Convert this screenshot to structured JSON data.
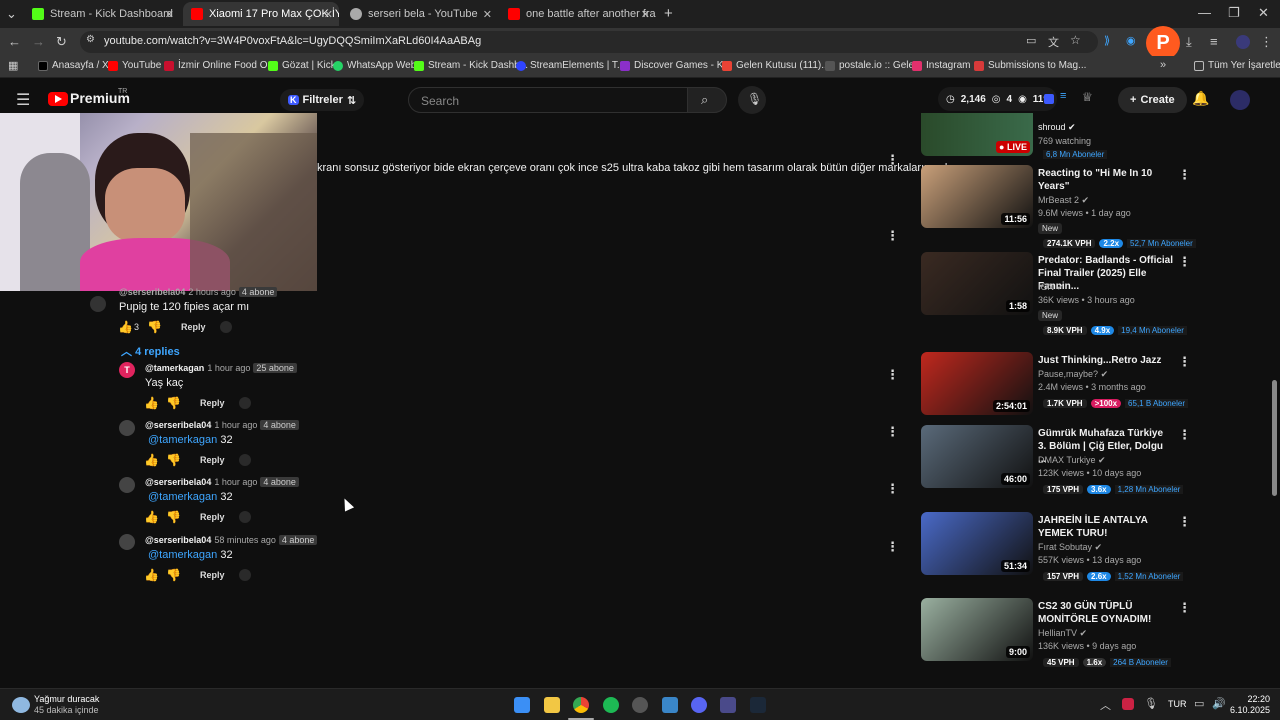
{
  "browser": {
    "tabs": [
      {
        "title": "Stream - Kick Dashboard",
        "color": "#53fc18",
        "active": false
      },
      {
        "title": "Xiaomi 17 Pro Max ÇOK İYİ (KU",
        "color": "#ff0000",
        "active": true
      },
      {
        "title": "serseri bela - YouTube",
        "color": "#aaaaaa",
        "active": false
      },
      {
        "title": "one battle after another fragma",
        "color": "#ff0000",
        "active": false
      }
    ],
    "url": "youtube.com/watch?v=3W4P0voxFtA&lc=UgyDQQSmiImXaRLd60I4AaABAg",
    "bookmarks": [
      {
        "label": "Anasayfa / X",
        "color": "#000000"
      },
      {
        "label": "YouTube",
        "color": "#ff0000"
      },
      {
        "label": "İzmir Online Food O...",
        "color": "#c8102e"
      },
      {
        "label": "Gözat | Kick",
        "color": "#53fc18"
      },
      {
        "label": "WhatsApp Web",
        "color": "#25d366"
      },
      {
        "label": "Stream - Kick Dashb...",
        "color": "#53fc18"
      },
      {
        "label": "StreamElements | T...",
        "color": "#2f44ff"
      },
      {
        "label": "Discover Games - K...",
        "color": "#8b2fc9"
      },
      {
        "label": "Gelen Kutusu (111)...",
        "color": "#ea4335"
      },
      {
        "label": "postale.io :: Gelen",
        "color": "#555555"
      },
      {
        "label": "Instagram",
        "color": "#e1306c"
      },
      {
        "label": "Submissions to Mag...",
        "color": "#d73a3a"
      }
    ],
    "all_bookmarks": "Tüm Yer İşaretleri"
  },
  "youtube": {
    "logo": "Premium",
    "region": "TR",
    "filter_label": "Filtreler",
    "search_placeholder": "Search",
    "stats": {
      "a": "2,146",
      "b": "4",
      "c": "119"
    },
    "create_label": "Create"
  },
  "comments": {
    "top_text": "kranı sonsuz gösteriyor bide ekran çerçeve oranı çok ince s25 ultra kaba takoz gibi hem tasarım olarak bütün diğer markaların çok",
    "parent": {
      "handle": "@serseribela04",
      "time": "2 hours ago",
      "badge": "4 abone",
      "text": "Pupig te 120 fipies açar mı",
      "likes": "3",
      "reply": "Reply"
    },
    "replies_toggle": "4 replies",
    "replies": [
      {
        "handle": "@tamerkagan",
        "time": "1 hour ago",
        "badge": "25 abone",
        "mention": "",
        "text": "Yaş kaç",
        "reply": "Reply",
        "avatar_color": "#e0245e",
        "avatar_letter": "T"
      },
      {
        "handle": "@serseribela04",
        "time": "1 hour ago",
        "badge": "4 abone",
        "mention": "@tamerkagan",
        "text": "32",
        "reply": "Reply",
        "avatar_color": "#444444",
        "avatar_letter": ""
      },
      {
        "handle": "@serseribela04",
        "time": "1 hour ago",
        "badge": "4 abone",
        "mention": "@tamerkagan",
        "text": "32",
        "reply": "Reply",
        "avatar_color": "#444444",
        "avatar_letter": ""
      },
      {
        "handle": "@serseribela04",
        "time": "58 minutes ago",
        "badge": "4 abone",
        "mention": "@tamerkagan",
        "text": "32",
        "reply": "Reply",
        "avatar_color": "#444444",
        "avatar_letter": ""
      }
    ]
  },
  "sidebar": {
    "top": {
      "channel": "shroud",
      "watching": "769 watching",
      "subs": "6,8 Mn Aboneler",
      "live": "LIVE"
    },
    "videos": [
      {
        "title": "Reacting to \"Hi Me In 10 Years\"",
        "channel": "MrBeast 2",
        "meta": "9.6M views • 1 day ago",
        "new": "New",
        "vph": "274.1K VPH",
        "mult": "2.2x",
        "mult_color": "#1e88e5",
        "subs": "52,7 Mn Aboneler",
        "duration": "11:56",
        "thumb": "#c9a07a"
      },
      {
        "title": "Predator: Badlands - Official Final Trailer (2025) Elle Fannin...",
        "channel": "IGN",
        "meta": "36K views • 3 hours ago",
        "new": "New",
        "vph": "8.9K VPH",
        "mult": "4.9x",
        "mult_color": "#1e88e5",
        "subs": "19,4 Mn Aboneler",
        "duration": "1:58",
        "thumb": "#3a2a22"
      },
      {
        "title": "Just Thinking...Retro Jazz",
        "channel": "Pause,maybe?",
        "meta": "2.4M views • 3 months ago",
        "new": "",
        "vph": "1.7K VPH",
        "mult": ">100x",
        "mult_color": "#d81b60",
        "subs": "65,1 B Aboneler",
        "duration": "2:54:01",
        "thumb": "#c0281e"
      },
      {
        "title": "Gümrük Muhafaza Türkiye 3. Bölüm | Çiğ Etler, Dolgu ...",
        "channel": "DMAX Turkiye",
        "meta": "123K views • 10 days ago",
        "new": "",
        "vph": "175 VPH",
        "mult": "3.6x",
        "mult_color": "#1e88e5",
        "subs": "1,28 Mn Aboneler",
        "duration": "46:00",
        "thumb": "#5a6a7a"
      },
      {
        "title": "JAHREİN İLE ANTALYA YEMEK TURU!",
        "channel": "Fırat Sobutay",
        "meta": "557K views • 13 days ago",
        "new": "",
        "vph": "157 VPH",
        "mult": "2.6x",
        "mult_color": "#1e88e5",
        "subs": "1,52 Mn Aboneler",
        "duration": "51:34",
        "thumb": "#4a6ac8"
      },
      {
        "title": "CS2 30 GÜN TÜPLÜ MONİTÖRLE OYNADIM!",
        "channel": "HellianTV",
        "meta": "136K views • 9 days ago",
        "new": "",
        "vph": "45 VPH",
        "mult": "1.6x",
        "mult_color": "#333333",
        "subs": "264 B Aboneler",
        "duration": "9:00",
        "thumb": "#9ab0a0"
      }
    ]
  },
  "taskbar": {
    "weather_title": "Yağmur duracak",
    "weather_sub": "45 dakika içinde",
    "lang": "TUR",
    "time": "22:20",
    "date": "6.10.2025"
  }
}
